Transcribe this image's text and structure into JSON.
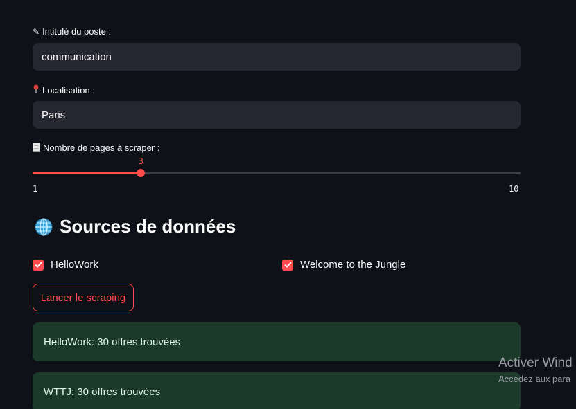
{
  "form": {
    "job_title_label": "Intitulé du poste :",
    "job_title_icon": "pencil-icon",
    "job_title_value": "communication",
    "location_label": "Localisation :",
    "location_icon": "pin-icon",
    "location_value": "Paris",
    "pages_label": "Nombre de pages à scraper :",
    "pages_icon": "document-icon",
    "pages_value": "3",
    "pages_min": "1",
    "pages_max": "10",
    "pages_fraction": 0.2222
  },
  "sources": {
    "title": "Sources de données",
    "title_icon": "globe-icon",
    "options": [
      {
        "label": "HelloWork",
        "checked": true
      },
      {
        "label": "Welcome to the Jungle",
        "checked": true
      }
    ]
  },
  "actions": {
    "run_label": "Lancer le scraping"
  },
  "results": [
    {
      "text": "HelloWork: 30 offres trouvées"
    },
    {
      "text": "WTTJ: 30 offres trouvées"
    }
  ],
  "watermark": {
    "line1": "Activer Wind",
    "line2": "Accédez aux para"
  },
  "colors": {
    "accent": "#ff4b4b",
    "background": "#0e1117",
    "input_bg": "#262730",
    "success_bg": "#1c3a2a"
  }
}
